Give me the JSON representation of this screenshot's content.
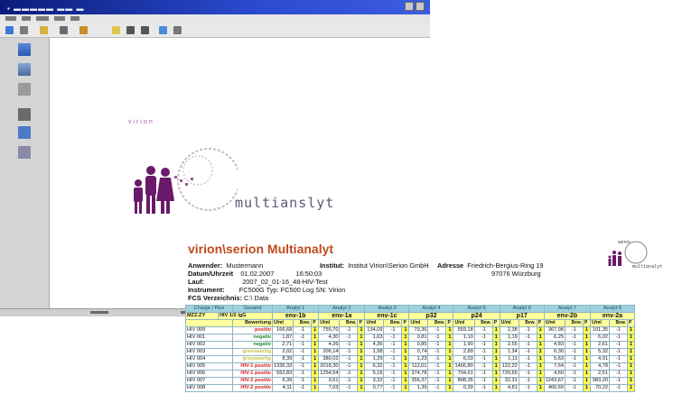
{
  "report": {
    "title": "virion\\serion Multianalyt",
    "anwender_label": "Anwender:",
    "anwender": "Mustermann",
    "institut_label": "Institut:",
    "institut": "Institut Virion\\Serion GmbH",
    "adresse_label": "Adresse",
    "adresse_line1": "Friedrich-Bergius-Ring 19",
    "adresse_line2": "97076 Würzburg",
    "datum_label": "Datum/Uhrzeit",
    "datum": "01.02.2007",
    "uhrzeit": "16:50:03",
    "lauf_label": "Lauf:",
    "lauf": "2007_02_01-16_48-HIV-Test",
    "instrument_label": "Instrument:",
    "instrument": "FC500G   Typ: FC500 Log   SN: Virion",
    "fcs_label": "FCS Verzeichnis:",
    "fcs": "C:\\ Data",
    "logo_small_top": "serion",
    "logo_small_bottom": "multianalyt"
  },
  "logo": {
    "top_text": "virion",
    "text": "multianslyt"
  },
  "table": {
    "header1": {
      "charge": "Charge / Plex",
      "gesamt": "Gesamt",
      "analytes": [
        "Analyt 1",
        "Analyt 2",
        "Analyt 3",
        "Analyt 4",
        "Analyt 5",
        "Analyt 6",
        "Analyt 7",
        "Analyt 8"
      ]
    },
    "header2": {
      "code": "MZZ.ZY",
      "assay": "HIV 1/2 IgG",
      "names": [
        "env-1b",
        "env-1a",
        "env-1c",
        "p32",
        "p24",
        "p17",
        "env-2b",
        "env-2a"
      ]
    },
    "header3": {
      "bewertung": "Bewertung",
      "unit": "U/ml",
      "bew": "Bew.",
      "p": "P"
    },
    "rows": [
      {
        "id": "HIV 009",
        "result": "positiv",
        "cls": "c-pos",
        "vals": [
          "166,68",
          "755,70",
          "134,09",
          "79,36",
          "559,18",
          "2,38",
          "367,98",
          "101,35"
        ]
      },
      {
        "id": "HIV 001",
        "result": "negativ",
        "cls": "c-neg",
        "vals": [
          "1,87",
          "4,30",
          "1,63",
          "0,81",
          "1,10",
          "1,19",
          "6,25",
          "6,02"
        ]
      },
      {
        "id": "HIV 002",
        "result": "negativ",
        "cls": "c-neg",
        "vals": [
          "2,71",
          "4,26",
          "4,36",
          "0,85",
          "1,90",
          "2,55",
          "4,83",
          "2,61"
        ]
      },
      {
        "id": "HIV 003",
        "result": "grenzwertig",
        "cls": "c-gren",
        "vals": [
          "2,02",
          "206,14",
          "1,58",
          "0,74",
          "2,89",
          "1,34",
          "6,30",
          "5,32"
        ]
      },
      {
        "id": "HIV 004",
        "result": "grenzwertig",
        "cls": "c-gren",
        "vals": [
          "8,39",
          "380,02",
          "1,29",
          "1,23",
          "6,03",
          "1,11",
          "5,63",
          "4,91"
        ]
      },
      {
        "id": "HIV 005",
        "result": "HIV-1 positiv",
        "cls": "c-pos",
        "vals": [
          "1336,33",
          "2018,30",
          "6,32",
          "112,01",
          "1466,80",
          "122,22",
          "7,64",
          "4,78"
        ]
      },
      {
        "id": "HIV 006",
        "result": "HIV-1 positiv",
        "cls": "c-pos",
        "vals": [
          "552,83",
          "1254,54",
          "5,16",
          "374,78",
          "704,61",
          "720,65",
          "4,60",
          "2,51"
        ]
      },
      {
        "id": "HIV 007",
        "result": "HIV-2 positiv",
        "cls": "c-pos",
        "vals": [
          "6,39",
          "9,51",
          "3,32",
          "356,37",
          "808,35",
          "32,31",
          "1243,67",
          "983,20"
        ]
      },
      {
        "id": "HIV 008",
        "result": "HIV-2 positiv",
        "cls": "c-pos",
        "vals": [
          "4,11",
          "7,03",
          "0,77",
          "1,39",
          "0,39",
          "4,81",
          "460,69",
          "70,22"
        ]
      }
    ],
    "bew_value": "-1",
    "p_value": "1"
  }
}
